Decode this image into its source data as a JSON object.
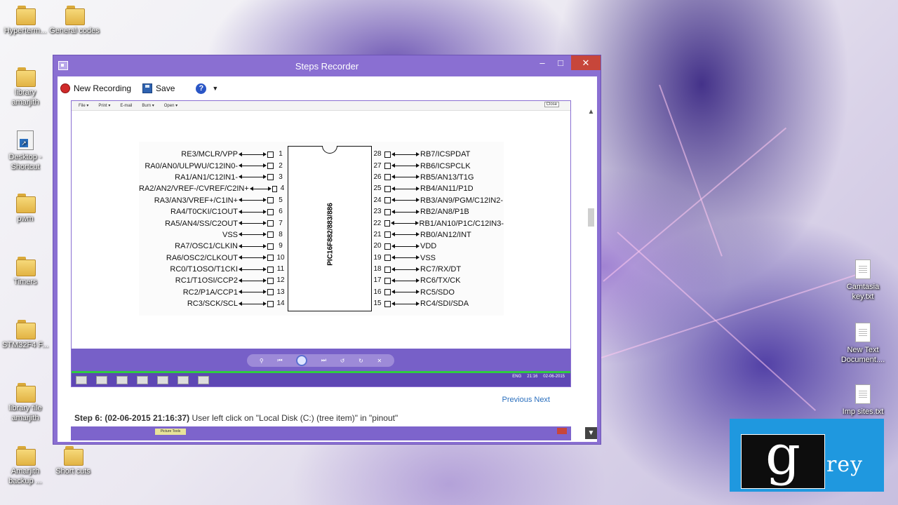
{
  "desktop": {
    "icons_left": [
      {
        "label": "Hyperterm...",
        "type": "folder"
      },
      {
        "label": "General codes",
        "type": "folder"
      },
      {
        "label": "library amarjith",
        "type": "folder"
      },
      {
        "label": "Desktop - Shortcut",
        "type": "shortcut"
      },
      {
        "label": "pwm",
        "type": "folder"
      },
      {
        "label": "Timers",
        "type": "folder"
      },
      {
        "label": "STM32F4 F...",
        "type": "folder"
      },
      {
        "label": "library file amarjith",
        "type": "folder"
      },
      {
        "label": "Amarjith backup ...",
        "type": "folder"
      },
      {
        "label": "Short cuts",
        "type": "folder"
      }
    ],
    "icons_right": [
      {
        "label": "Camtasia key.txt",
        "type": "document"
      },
      {
        "label": "New Text Document....",
        "type": "document"
      },
      {
        "label": "Imp sites.txt",
        "type": "document"
      }
    ]
  },
  "window": {
    "title": "Steps Recorder",
    "controls": {
      "minimize": "–",
      "maximize": "□",
      "close": "✕"
    }
  },
  "toolbar": {
    "new_recording": "New Recording",
    "save": "Save",
    "help": "?",
    "help_dropdown": "▼"
  },
  "screenshot": {
    "menu": [
      "File ▾",
      "Print ▾",
      "E-mail",
      "Burn ▾",
      "Open ▾"
    ],
    "close_label": "Close",
    "chip_label": "PIC16F882/883/886",
    "left_pins": [
      {
        "num": "1",
        "name": "RE3/MCLR/VPP"
      },
      {
        "num": "2",
        "name": "RA0/AN0/ULPWU/C12IN0-"
      },
      {
        "num": "3",
        "name": "RA1/AN1/C12IN1-"
      },
      {
        "num": "4",
        "name": "RA2/AN2/VREF-/CVREF/C2IN+"
      },
      {
        "num": "5",
        "name": "RA3/AN3/VREF+/C1IN+"
      },
      {
        "num": "6",
        "name": "RA4/T0CKI/C1OUT"
      },
      {
        "num": "7",
        "name": "RA5/AN4/SS/C2OUT"
      },
      {
        "num": "8",
        "name": "VSS"
      },
      {
        "num": "9",
        "name": "RA7/OSC1/CLKIN"
      },
      {
        "num": "10",
        "name": "RA6/OSC2/CLKOUT"
      },
      {
        "num": "11",
        "name": "RC0/T1OSO/T1CKI"
      },
      {
        "num": "12",
        "name": "RC1/T1OSI/CCP2"
      },
      {
        "num": "13",
        "name": "RC2/P1A/CCP1"
      },
      {
        "num": "14",
        "name": "RC3/SCK/SCL"
      }
    ],
    "right_pins": [
      {
        "num": "28",
        "name": "RB7/ICSPDAT"
      },
      {
        "num": "27",
        "name": "RB6/ICSPCLK"
      },
      {
        "num": "26",
        "name": "RB5/AN13/T1G"
      },
      {
        "num": "25",
        "name": "RB4/AN11/P1D"
      },
      {
        "num": "24",
        "name": "RB3/AN9/PGM/C12IN2-"
      },
      {
        "num": "23",
        "name": "RB2/AN8/P1B"
      },
      {
        "num": "22",
        "name": "RB1/AN10/P1C/C12IN3-"
      },
      {
        "num": "21",
        "name": "RB0/AN12/INT"
      },
      {
        "num": "20",
        "name": "VDD"
      },
      {
        "num": "19",
        "name": "VSS"
      },
      {
        "num": "18",
        "name": "RC7/RX/DT"
      },
      {
        "num": "17",
        "name": "RC6/TX/CK"
      },
      {
        "num": "16",
        "name": "RC5/SDO"
      },
      {
        "num": "15",
        "name": "RC4/SDI/SDA"
      }
    ],
    "tray": {
      "lang": "ENG",
      "time": "21:16",
      "date": "02-06-2015"
    },
    "progress": 1.0
  },
  "steps": {
    "previous_label": "Previous",
    "next_label": "Next",
    "step_heading": "Step 6: (02-06-2015 21:16:37)",
    "step_text": "User left click on \"Local Disk (C:) (tree item)\" in \"pinout\"",
    "next_shot_tab": "Picture Tools"
  },
  "logo": {
    "letter": "g",
    "rest": "rey"
  }
}
